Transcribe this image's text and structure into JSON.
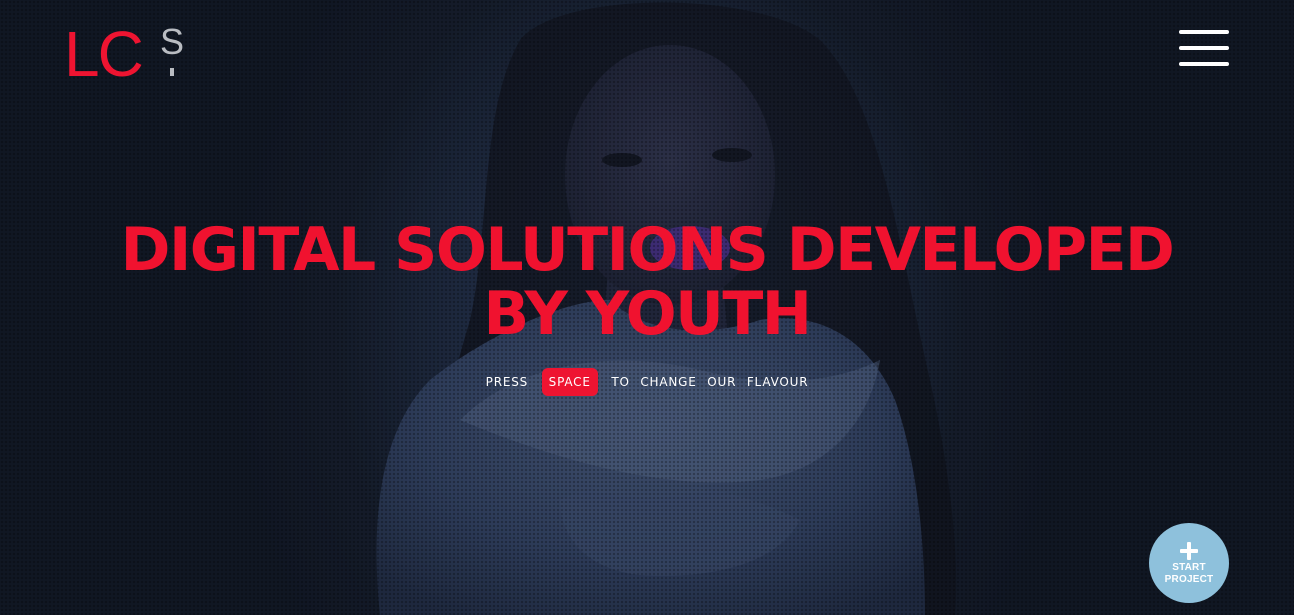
{
  "brand": {
    "logo_main": "LC",
    "logo_sub": "S"
  },
  "hero": {
    "headline_line1": "DIGITAL SOLUTIONS DEVELOPED",
    "headline_line2": "BY YOUTH",
    "press_word": "PRESS",
    "space_key": "SPACE",
    "to_word": "TO",
    "change_word": "CHANGE",
    "our_word": "OUR",
    "flavour_word": "FLAVOUR"
  },
  "cta": {
    "line1": "START",
    "line2": "PROJECT"
  },
  "icons": {
    "menu": "hamburger-menu-icon",
    "start": "plus-icon"
  },
  "colors": {
    "accent": "#ee1431",
    "cta_bg": "#8ec1dc",
    "background": "#141c2a"
  }
}
